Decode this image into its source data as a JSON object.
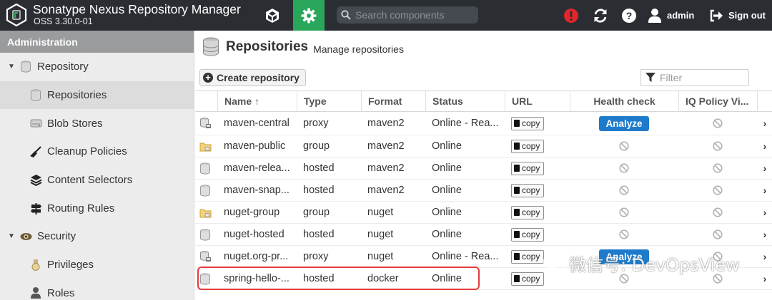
{
  "app": {
    "title": "Sonatype Nexus Repository Manager",
    "version": "OSS 3.30.0-01"
  },
  "topbar": {
    "search_placeholder": "Search components",
    "user_label": "admin",
    "signout_label": "Sign out",
    "icons": [
      "cube-icon",
      "gear-icon",
      "search-icon",
      "alert-icon",
      "refresh-icon",
      "help-icon",
      "user-icon",
      "signout-icon"
    ],
    "accent_color": "#29a65a",
    "alert_color": "#e0262a"
  },
  "sidebar": {
    "header": "Administration",
    "items": [
      {
        "label": "Repository",
        "kind": "group",
        "icon": "database-icon"
      },
      {
        "label": "Repositories",
        "kind": "child",
        "icon": "database-icon",
        "selected": true
      },
      {
        "label": "Blob Stores",
        "kind": "child",
        "icon": "hard-drive-icon"
      },
      {
        "label": "Cleanup Policies",
        "kind": "child",
        "icon": "broom-icon"
      },
      {
        "label": "Content Selectors",
        "kind": "child",
        "icon": "layers-icon"
      },
      {
        "label": "Routing Rules",
        "kind": "child",
        "icon": "signpost-icon"
      },
      {
        "label": "Security",
        "kind": "group",
        "icon": "eye-icon"
      },
      {
        "label": "Privileges",
        "kind": "child",
        "icon": "medal-icon"
      },
      {
        "label": "Roles",
        "kind": "child",
        "icon": "user-role-icon"
      }
    ]
  },
  "main": {
    "title": "Repositories",
    "subtitle": "Manage repositories",
    "create_label": "Create repository",
    "filter_placeholder": "Filter",
    "columns": {
      "name": "Name ↑",
      "type": "Type",
      "format": "Format",
      "status": "Status",
      "url": "URL",
      "health": "Health check",
      "iq": "IQ Policy Vi..."
    },
    "copy_label": "copy",
    "analyze_label": "Analyze",
    "rows": [
      {
        "icon": "proxy-repo-icon",
        "name": "maven-central",
        "type": "proxy",
        "format": "maven2",
        "status": "Online - Rea...",
        "health": "analyze"
      },
      {
        "icon": "group-repo-icon",
        "name": "maven-public",
        "type": "group",
        "format": "maven2",
        "status": "Online",
        "health": "none"
      },
      {
        "icon": "hosted-repo-icon",
        "name": "maven-relea...",
        "type": "hosted",
        "format": "maven2",
        "status": "Online",
        "health": "none"
      },
      {
        "icon": "hosted-repo-icon",
        "name": "maven-snap...",
        "type": "hosted",
        "format": "maven2",
        "status": "Online",
        "health": "none"
      },
      {
        "icon": "group-repo-icon",
        "name": "nuget-group",
        "type": "group",
        "format": "nuget",
        "status": "Online",
        "health": "none"
      },
      {
        "icon": "hosted-repo-icon",
        "name": "nuget-hosted",
        "type": "hosted",
        "format": "nuget",
        "status": "Online",
        "health": "none"
      },
      {
        "icon": "proxy-repo-icon",
        "name": "nuget.org-pr...",
        "type": "proxy",
        "format": "nuget",
        "status": "Online - Rea...",
        "health": "analyze"
      },
      {
        "icon": "hosted-repo-icon",
        "name": "spring-hello-...",
        "type": "hosted",
        "format": "docker",
        "status": "Online",
        "health": "none"
      }
    ]
  },
  "watermark": {
    "text": "微信号: DevOpsView",
    "icon": "wechat-icon"
  }
}
